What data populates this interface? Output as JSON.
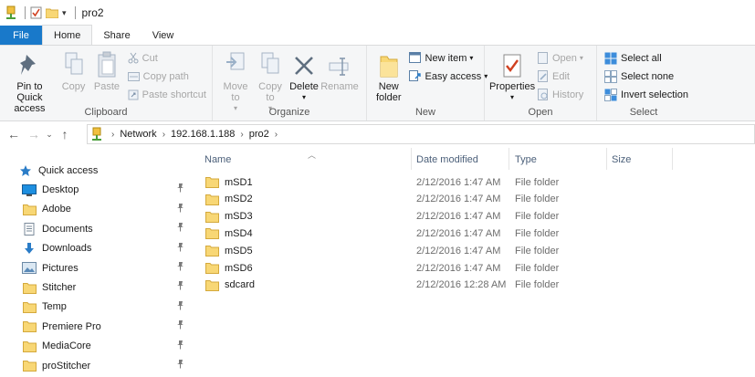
{
  "window": {
    "title": "pro2"
  },
  "tabs": {
    "file": "File",
    "home": "Home",
    "share": "Share",
    "view": "View"
  },
  "ribbon": {
    "clipboard": {
      "label": "Clipboard",
      "pin": "Pin to Quick access",
      "copy": "Copy",
      "paste": "Paste",
      "cut": "Cut",
      "copy_path": "Copy path",
      "paste_shortcut": "Paste shortcut"
    },
    "organize": {
      "label": "Organize",
      "move_to": "Move to",
      "copy_to": "Copy to",
      "delete": "Delete",
      "rename": "Rename"
    },
    "new": {
      "label": "New",
      "new_folder": "New folder",
      "new_item": "New item",
      "easy_access": "Easy access"
    },
    "open": {
      "label": "Open",
      "properties": "Properties",
      "open": "Open",
      "edit": "Edit",
      "history": "History"
    },
    "select": {
      "label": "Select",
      "select_all": "Select all",
      "select_none": "Select none",
      "invert": "Invert selection"
    }
  },
  "address": {
    "crumbs": [
      "Network",
      "192.168.1.188",
      "pro2"
    ]
  },
  "sidebar": {
    "quick_access": "Quick access",
    "items": [
      {
        "label": "Desktop",
        "icon": "desktop-icon"
      },
      {
        "label": "Adobe",
        "icon": "folder-icon"
      },
      {
        "label": "Documents",
        "icon": "documents-icon"
      },
      {
        "label": "Downloads",
        "icon": "download-icon"
      },
      {
        "label": "Pictures",
        "icon": "pictures-icon"
      },
      {
        "label": "Stitcher",
        "icon": "folder-icon"
      },
      {
        "label": "Temp",
        "icon": "folder-icon"
      },
      {
        "label": "Premiere Pro",
        "icon": "folder-icon"
      },
      {
        "label": "MediaCore",
        "icon": "folder-icon"
      },
      {
        "label": "proStitcher",
        "icon": "folder-icon"
      }
    ]
  },
  "columns": {
    "name": "Name",
    "date": "Date modified",
    "type": "Type",
    "size": "Size"
  },
  "files": [
    {
      "name": "mSD1",
      "date": "2/12/2016 1:47 AM",
      "type": "File folder"
    },
    {
      "name": "mSD2",
      "date": "2/12/2016 1:47 AM",
      "type": "File folder"
    },
    {
      "name": "mSD3",
      "date": "2/12/2016 1:47 AM",
      "type": "File folder"
    },
    {
      "name": "mSD4",
      "date": "2/12/2016 1:47 AM",
      "type": "File folder"
    },
    {
      "name": "mSD5",
      "date": "2/12/2016 1:47 AM",
      "type": "File folder"
    },
    {
      "name": "mSD6",
      "date": "2/12/2016 1:47 AM",
      "type": "File folder"
    },
    {
      "name": "sdcard",
      "date": "2/12/2016 12:28 AM",
      "type": "File folder"
    }
  ],
  "colors": {
    "accent": "#1979ca",
    "folder": "#f8d775",
    "ribbon_bg": "#f5f6f7"
  }
}
